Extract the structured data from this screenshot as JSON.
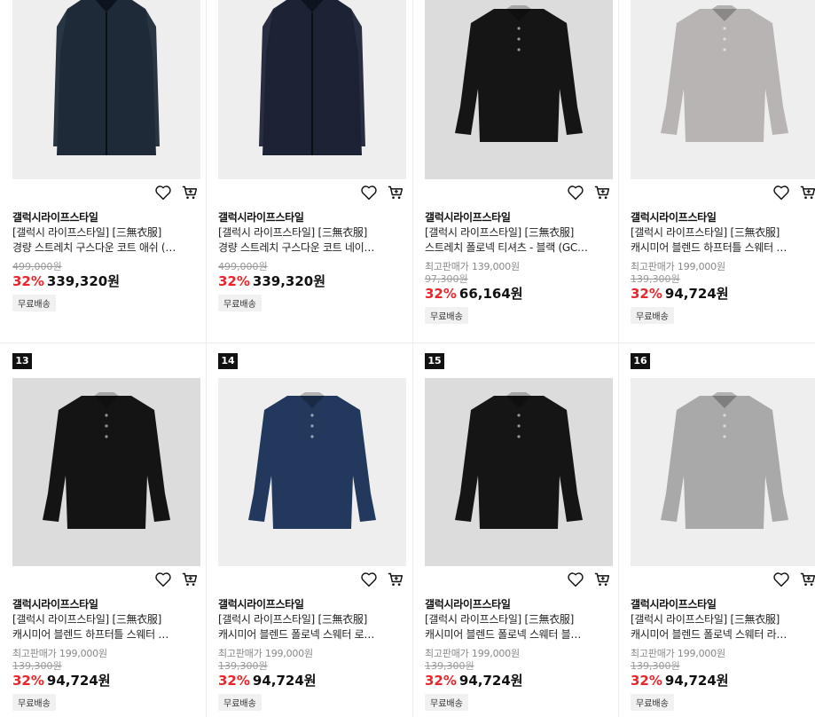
{
  "products": [
    {
      "brand": "갤럭시라이프스타일",
      "title1": "[갤럭시 라이프스타일] [三無衣服]",
      "title2": "경량 스트레치 구스다운 코트 애쉬 (…",
      "max_price": "",
      "orig_price": "499,000원",
      "discount": "32%",
      "price": "339,320원",
      "shipping": "무료배송",
      "badge": "",
      "color": "#1f2a38",
      "kind": "coat"
    },
    {
      "brand": "갤럭시라이프스타일",
      "title1": "[갤럭시 라이프스타일] [三無衣服]",
      "title2": "경량 스트레치 구스다운 코트 네이…",
      "max_price": "",
      "orig_price": "499,000원",
      "discount": "32%",
      "price": "339,320원",
      "shipping": "무료배송",
      "badge": "",
      "color": "#1c2335",
      "kind": "coat"
    },
    {
      "brand": "갤럭시라이프스타일",
      "title1": "[갤럭시 라이프스타일] [三無衣服]",
      "title2": "스트레치 폴로넥 티셔츠 - 블랙 (GC…",
      "max_price": "최고판매가 139,000원",
      "orig_price": "97,300원",
      "discount": "32%",
      "price": "66,164원",
      "shipping": "무료배송",
      "badge": "",
      "color": "#151515",
      "kind": "polo"
    },
    {
      "brand": "갤럭시라이프스타일",
      "title1": "[갤럭시 라이프스타일] [三無衣服]",
      "title2": "캐시미어 블렌드 하프터틀 스웨터 …",
      "max_price": "최고판매가 199,000원",
      "orig_price": "139,300원",
      "discount": "32%",
      "price": "94,724원",
      "shipping": "무료배송",
      "badge": "",
      "color": "#b9b4b4",
      "kind": "polo"
    },
    {
      "brand": "갤럭시라이프스타일",
      "title1": "[갤럭시 라이프스타일] [三無衣服]",
      "title2": "캐시미어 블렌드 하프터틀 스웨터 …",
      "max_price": "최고판매가 199,000원",
      "orig_price": "139,300원",
      "discount": "32%",
      "price": "94,724원",
      "shipping": "무료배송",
      "badge": "13",
      "color": "#141414",
      "kind": "polo"
    },
    {
      "brand": "갤럭시라이프스타일",
      "title1": "[갤럭시 라이프스타일] [三無衣服]",
      "title2": "캐시미어 블렌드 폴로넥 스웨터 로…",
      "max_price": "최고판매가 199,000원",
      "orig_price": "139,300원",
      "discount": "32%",
      "price": "94,724원",
      "shipping": "무료배송",
      "badge": "14",
      "color": "#22385c",
      "kind": "polo"
    },
    {
      "brand": "갤럭시라이프스타일",
      "title1": "[갤럭시 라이프스타일] [三無衣服]",
      "title2": "캐시미어 블렌드 폴로넥 스웨터 블…",
      "max_price": "최고판매가 199,000원",
      "orig_price": "139,300원",
      "discount": "32%",
      "price": "94,724원",
      "shipping": "무료배송",
      "badge": "15",
      "color": "#151515",
      "kind": "polo"
    },
    {
      "brand": "갤럭시라이프스타일",
      "title1": "[갤럭시 라이프스타일] [三無衣服]",
      "title2": "캐시미어 블렌드 폴로넥 스웨터 라…",
      "max_price": "최고판매가 199,000원",
      "orig_price": "139,300원",
      "discount": "32%",
      "price": "94,724원",
      "shipping": "무료배송",
      "badge": "16",
      "color": "#a9a9a9",
      "kind": "polo"
    }
  ]
}
